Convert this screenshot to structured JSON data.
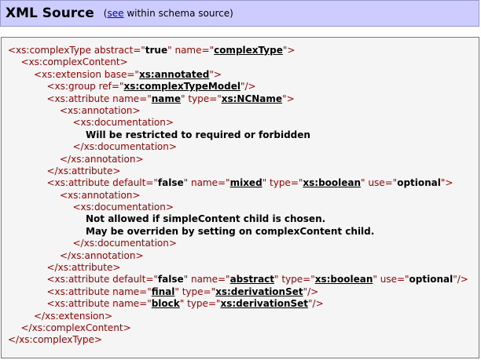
{
  "header": {
    "title": "XML Source",
    "note_prefix": "(",
    "note_link": "see",
    "note_suffix": " within schema source)"
  },
  "source": {
    "lines": [
      {
        "indent": 0,
        "parts": [
          [
            "tag",
            "<xs:complexType "
          ],
          [
            "attr",
            "abstract=\""
          ],
          [
            "val",
            "true"
          ],
          [
            "attr",
            "\" name=\""
          ],
          [
            "link",
            "complexType"
          ],
          [
            "attr",
            "\""
          ],
          [
            "tag",
            ">"
          ]
        ]
      },
      {
        "indent": 1,
        "parts": [
          [
            "tag",
            "<xs:complexContent>"
          ]
        ]
      },
      {
        "indent": 2,
        "parts": [
          [
            "tag",
            "<xs:extension "
          ],
          [
            "attr",
            "base=\""
          ],
          [
            "link",
            "xs:annotated"
          ],
          [
            "attr",
            "\""
          ],
          [
            "tag",
            ">"
          ]
        ]
      },
      {
        "indent": 3,
        "parts": [
          [
            "tag",
            "<xs:group "
          ],
          [
            "attr",
            "ref=\""
          ],
          [
            "link",
            "xs:complexTypeModel"
          ],
          [
            "attr",
            "\""
          ],
          [
            "tag",
            "/>"
          ]
        ]
      },
      {
        "indent": 3,
        "parts": [
          [
            "tag",
            "<xs:attribute "
          ],
          [
            "attr",
            "name=\""
          ],
          [
            "link",
            "name"
          ],
          [
            "attr",
            "\" type=\""
          ],
          [
            "link",
            "xs:NCName"
          ],
          [
            "attr",
            "\""
          ],
          [
            "tag",
            ">"
          ]
        ]
      },
      {
        "indent": 4,
        "parts": [
          [
            "tag",
            "<xs:annotation>"
          ]
        ]
      },
      {
        "indent": 5,
        "parts": [
          [
            "tag",
            "<xs:documentation>"
          ]
        ]
      },
      {
        "indent": 6,
        "parts": [
          [
            "txt",
            "Will be restricted to required or forbidden"
          ]
        ]
      },
      {
        "indent": 5,
        "parts": [
          [
            "tag",
            "</xs:documentation>"
          ]
        ]
      },
      {
        "indent": 4,
        "parts": [
          [
            "tag",
            "</xs:annotation>"
          ]
        ]
      },
      {
        "indent": 3,
        "parts": [
          [
            "tag",
            "</xs:attribute>"
          ]
        ]
      },
      {
        "indent": 3,
        "parts": [
          [
            "tag",
            "<xs:attribute "
          ],
          [
            "attr",
            "default=\""
          ],
          [
            "val",
            "false"
          ],
          [
            "attr",
            "\" name=\""
          ],
          [
            "link",
            "mixed"
          ],
          [
            "attr",
            "\" type=\""
          ],
          [
            "link",
            "xs:boolean"
          ],
          [
            "attr",
            "\" use=\""
          ],
          [
            "val",
            "optional"
          ],
          [
            "attr",
            "\""
          ],
          [
            "tag",
            ">"
          ]
        ]
      },
      {
        "indent": 4,
        "parts": [
          [
            "tag",
            "<xs:annotation>"
          ]
        ]
      },
      {
        "indent": 5,
        "parts": [
          [
            "tag",
            "<xs:documentation>"
          ]
        ]
      },
      {
        "indent": 6,
        "parts": [
          [
            "txt",
            "Not allowed if simpleContent child is chosen."
          ]
        ]
      },
      {
        "indent": 6,
        "parts": [
          [
            "txt",
            "May be overriden by setting on complexContent child."
          ]
        ]
      },
      {
        "indent": 5,
        "parts": [
          [
            "tag",
            "</xs:documentation>"
          ]
        ]
      },
      {
        "indent": 4,
        "parts": [
          [
            "tag",
            "</xs:annotation>"
          ]
        ]
      },
      {
        "indent": 3,
        "parts": [
          [
            "tag",
            "</xs:attribute>"
          ]
        ]
      },
      {
        "indent": 3,
        "parts": [
          [
            "tag",
            "<xs:attribute "
          ],
          [
            "attr",
            "default=\""
          ],
          [
            "val",
            "false"
          ],
          [
            "attr",
            "\" name=\""
          ],
          [
            "link",
            "abstract"
          ],
          [
            "attr",
            "\" type=\""
          ],
          [
            "link",
            "xs:boolean"
          ],
          [
            "attr",
            "\" use=\""
          ],
          [
            "val",
            "optional"
          ],
          [
            "attr",
            "\""
          ],
          [
            "tag",
            "/>"
          ]
        ]
      },
      {
        "indent": 3,
        "parts": [
          [
            "tag",
            "<xs:attribute "
          ],
          [
            "attr",
            "name=\""
          ],
          [
            "link",
            "final"
          ],
          [
            "attr",
            "\" type=\""
          ],
          [
            "link",
            "xs:derivationSet"
          ],
          [
            "attr",
            "\""
          ],
          [
            "tag",
            "/>"
          ]
        ]
      },
      {
        "indent": 3,
        "parts": [
          [
            "tag",
            "<xs:attribute "
          ],
          [
            "attr",
            "name=\""
          ],
          [
            "link",
            "block"
          ],
          [
            "attr",
            "\" type=\""
          ],
          [
            "link",
            "xs:derivationSet"
          ],
          [
            "attr",
            "\""
          ],
          [
            "tag",
            "/>"
          ]
        ]
      },
      {
        "indent": 2,
        "parts": [
          [
            "tag",
            "</xs:extension>"
          ]
        ]
      },
      {
        "indent": 1,
        "parts": [
          [
            "tag",
            "</xs:complexContent>"
          ]
        ]
      },
      {
        "indent": 0,
        "parts": [
          [
            "tag",
            "</xs:complexType>"
          ]
        ]
      }
    ]
  }
}
